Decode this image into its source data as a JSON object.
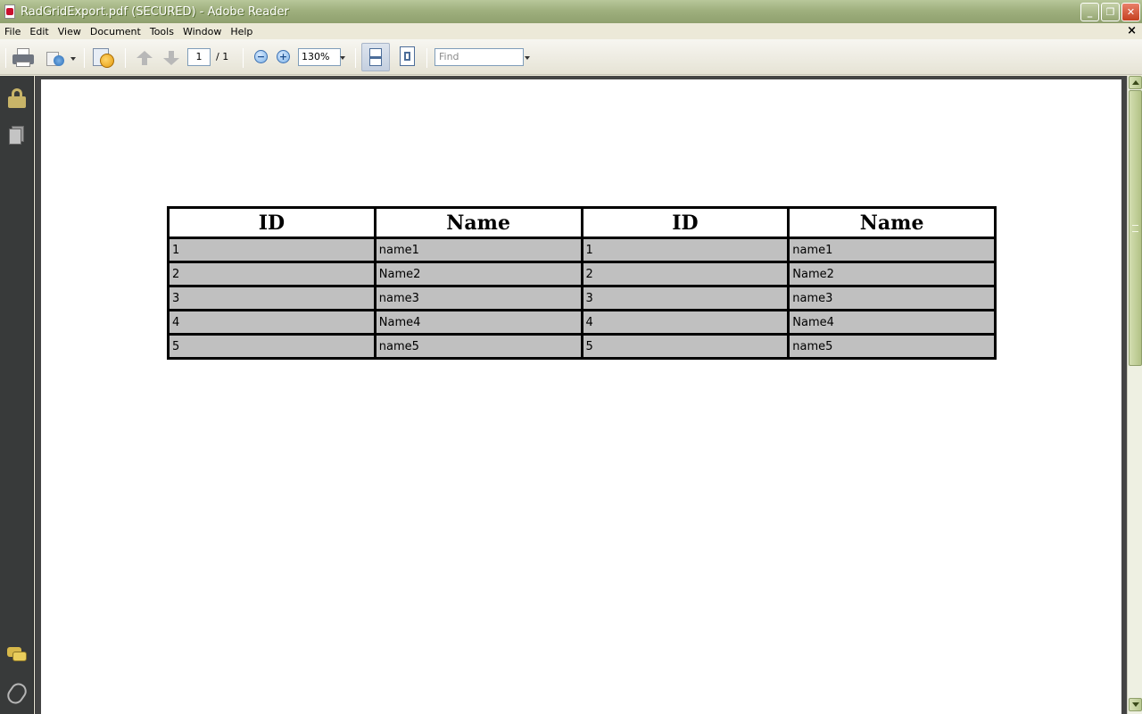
{
  "window": {
    "title": "RadGridExport.pdf (SECURED) - Adobe Reader",
    "minimize": "_",
    "restore": "❐",
    "close": "✕"
  },
  "menu": {
    "items": [
      "File",
      "Edit",
      "View",
      "Document",
      "Tools",
      "Window",
      "Help"
    ],
    "close_doc": "×"
  },
  "toolbar": {
    "page_current": "1",
    "page_total": "/  1",
    "zoom_out": "−",
    "zoom_in": "+",
    "zoom_value": "130%",
    "find_placeholder": "Find"
  },
  "document": {
    "table": {
      "headers": [
        "ID",
        "Name",
        "ID",
        "Name"
      ],
      "rows": [
        [
          "1",
          "name1",
          "1",
          "name1"
        ],
        [
          "2",
          "Name2",
          "2",
          "Name2"
        ],
        [
          "3",
          "name3",
          "3",
          "name3"
        ],
        [
          "4",
          "Name4",
          "4",
          "Name4"
        ],
        [
          "5",
          "name5",
          "5",
          "name5"
        ]
      ]
    }
  },
  "icons": {
    "app": "adobe-reader-icon",
    "print": "printer-icon",
    "collaborate": "collaborate-icon",
    "secure": "secure-document-icon",
    "prev_page": "arrow-up-icon",
    "next_page": "arrow-down-icon",
    "lock": "lock-icon",
    "pages": "pages-icon",
    "comments": "comments-icon",
    "attachments": "paperclip-icon"
  }
}
